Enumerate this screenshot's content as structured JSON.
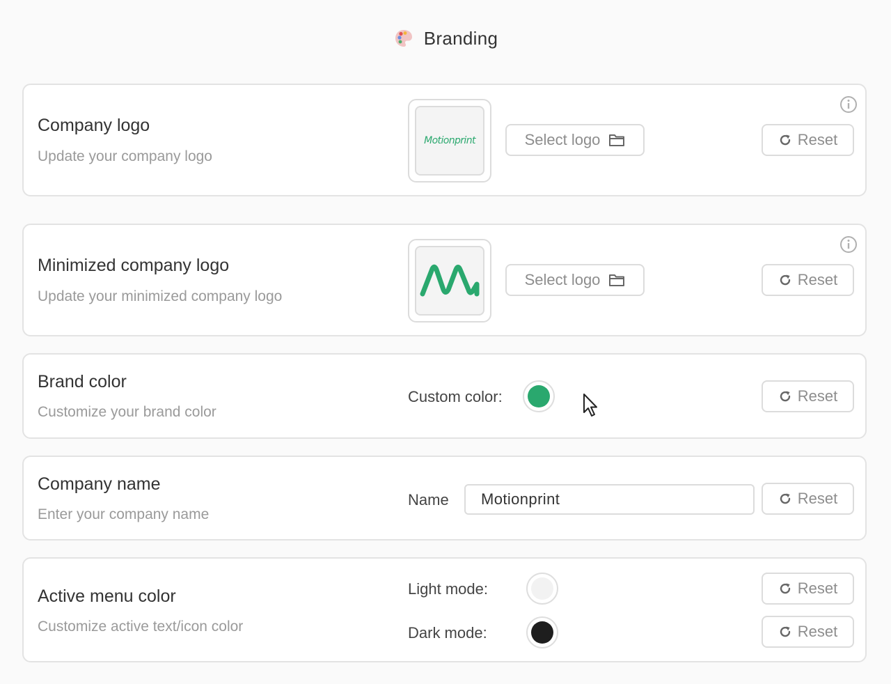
{
  "page": {
    "title": "Branding",
    "icons": {
      "page": "palette-icon",
      "info": "info-icon",
      "folder": "folder-icon",
      "reset": "refresh-icon",
      "cursor": "mouse-pointer-icon"
    }
  },
  "company_logo": {
    "title": "Company logo",
    "subtitle": "Update your company logo",
    "logo_text": "Motionprint",
    "select_label": "Select logo",
    "reset_label": "Reset"
  },
  "minimized_logo": {
    "title": "Minimized company logo",
    "subtitle": "Update your minimized company logo",
    "select_label": "Select logo",
    "reset_label": "Reset"
  },
  "brand_color": {
    "title": "Brand color",
    "subtitle": "Customize your brand color",
    "custom_color_label": "Custom color:",
    "custom_color": "#2aa86e",
    "reset_label": "Reset"
  },
  "company_name": {
    "title": "Company name",
    "subtitle": "Enter your company name",
    "field_label": "Name",
    "value": "Motionprint",
    "reset_label": "Reset"
  },
  "active_menu_color": {
    "title": "Active menu color",
    "subtitle": "Customize active text/icon color",
    "light_label": "Light mode:",
    "light_color": "#f2f2f2",
    "dark_label": "Dark mode:",
    "dark_color": "#1e1e1e",
    "reset_label": "Reset"
  }
}
